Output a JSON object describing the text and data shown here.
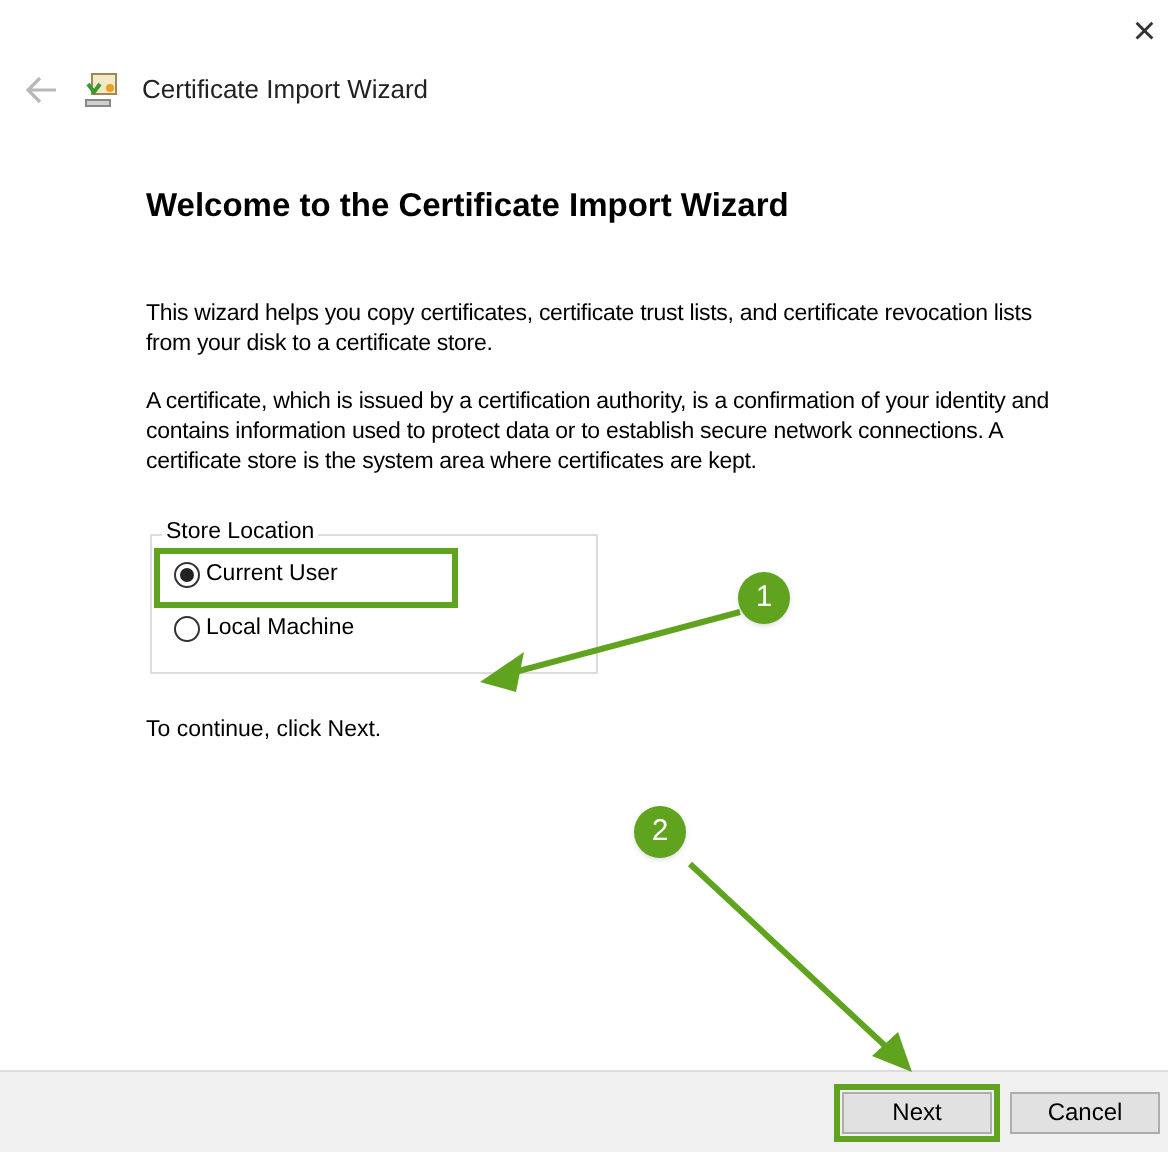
{
  "window": {
    "title": "Certificate Import Wizard",
    "close": "×"
  },
  "heading": "Welcome to the Certificate Import Wizard",
  "paragraphs": [
    "This wizard helps you copy certificates, certificate trust lists, and certificate revocation lists from your disk to a certificate store.",
    "A certificate, which is issued by a certification authority, is a confirmation of your identity and contains information used to protect data or to establish secure network connections. A certificate store is the system area where certificates are kept."
  ],
  "store_location": {
    "label": "Store Location",
    "options": [
      {
        "label": "Current User",
        "selected": true,
        "highlighted": true
      },
      {
        "label": "Local Machine",
        "selected": false,
        "highlighted": false
      }
    ]
  },
  "hint": "To continue, click Next.",
  "buttons": [
    {
      "label": "Next",
      "highlighted": true
    },
    {
      "label": "Cancel",
      "highlighted": false
    }
  ],
  "annotations": [
    {
      "number": "1"
    },
    {
      "number": "2"
    }
  ]
}
